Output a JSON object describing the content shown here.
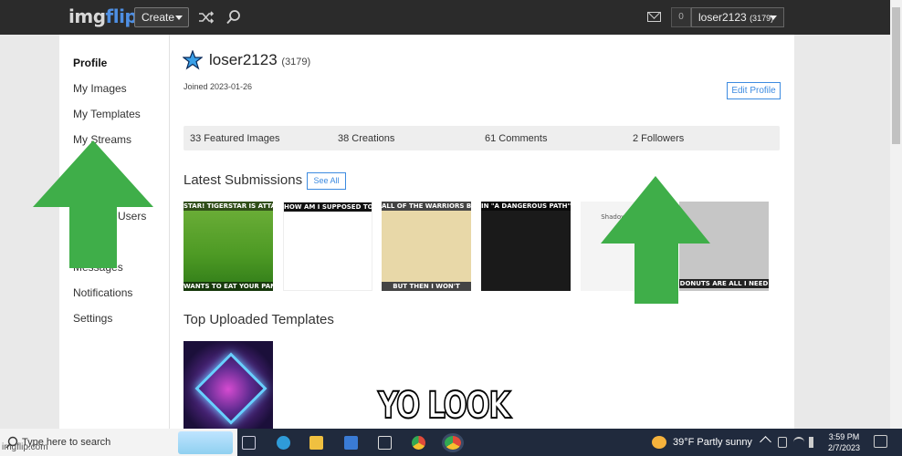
{
  "nav": {
    "logo_a": "img",
    "logo_b": "flip",
    "create_label": "Create",
    "notif_count": "0",
    "username": "loser2123",
    "user_points": "(3179)"
  },
  "sidebar": {
    "items": [
      {
        "label": "Profile",
        "active": true
      },
      {
        "label": "My Images"
      },
      {
        "label": "My Templates"
      },
      {
        "label": "My Streams"
      },
      {
        "label": "Users"
      },
      {
        "label": "Messages"
      },
      {
        "label": "Notifications"
      },
      {
        "label": "Settings"
      }
    ]
  },
  "profile": {
    "username": "loser2123",
    "points": "(3179)",
    "joined": "Joined 2023-01-26",
    "edit_label": "Edit Profile"
  },
  "stats": {
    "featured": "33 Featured Images",
    "creations": "38 Creations",
    "comments": "61 Comments",
    "followers": "2 Followers"
  },
  "latest": {
    "heading": "Latest Submissions",
    "see_all": "See All",
    "thumbs": [
      {
        "top": "STAR! TIGERSTAR IS ATTACK THE THINDERCLAN CAMP!",
        "bottom": "WANTS TO EAT YOUR PANCAK"
      },
      {
        "top": "HOW AM I SUPPOSED TO WHO THAT I FOLLOWER IS",
        "bottom": ""
      },
      {
        "top": "ALL OF THE WARRIORS BOOKS!!! (THE ERINS ONES)",
        "bottom": "BUT THEN I WON'T"
      },
      {
        "top": "IN \"A DANGEROUS PATH\": UPVOTE",
        "bottom": ""
      },
      {
        "top": "Shadowclan Ca",
        "bottom": ""
      },
      {
        "top": "",
        "bottom": "DONUTS ARE ALL I NEED"
      }
    ]
  },
  "templates": {
    "heading": "Top Uploaded Templates"
  },
  "meme_caption": "YO LOOK",
  "taskbar": {
    "search_placeholder": "Type here to search",
    "weather": "39°F  Partly sunny",
    "time": "3:59 PM",
    "date": "2/7/2023"
  },
  "watermark": "imgflip.com",
  "colors": {
    "accent": "#3d8be0",
    "arrow_green": "#3fae49",
    "topbar": "#2b2b2b"
  }
}
